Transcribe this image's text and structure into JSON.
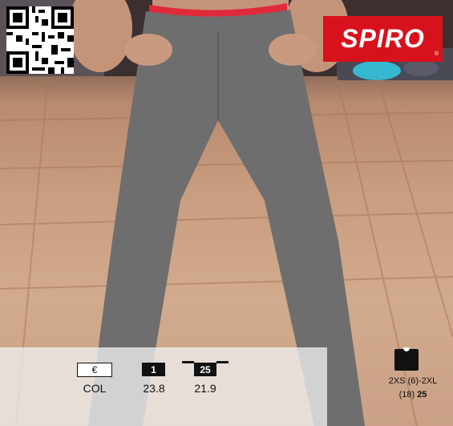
{
  "brand": {
    "name": "SPIRO",
    "reg": "®"
  },
  "price": {
    "currency_symbol": "€",
    "label": "COL"
  },
  "tier_1": {
    "quantity": "1",
    "price": "23.8"
  },
  "tier_25": {
    "quantity": "25",
    "price": "21.9"
  },
  "sizes": {
    "range": "2XS (6)-2XL",
    "count_prefix": "(18)",
    "count_value": "25"
  },
  "colors": {
    "brand_red": "#d8121c",
    "leggings_grey": "#6e6e6e",
    "waistband": "#e02a3a"
  },
  "icons": [
    "qr-code-icon",
    "size-shirt-icon"
  ]
}
